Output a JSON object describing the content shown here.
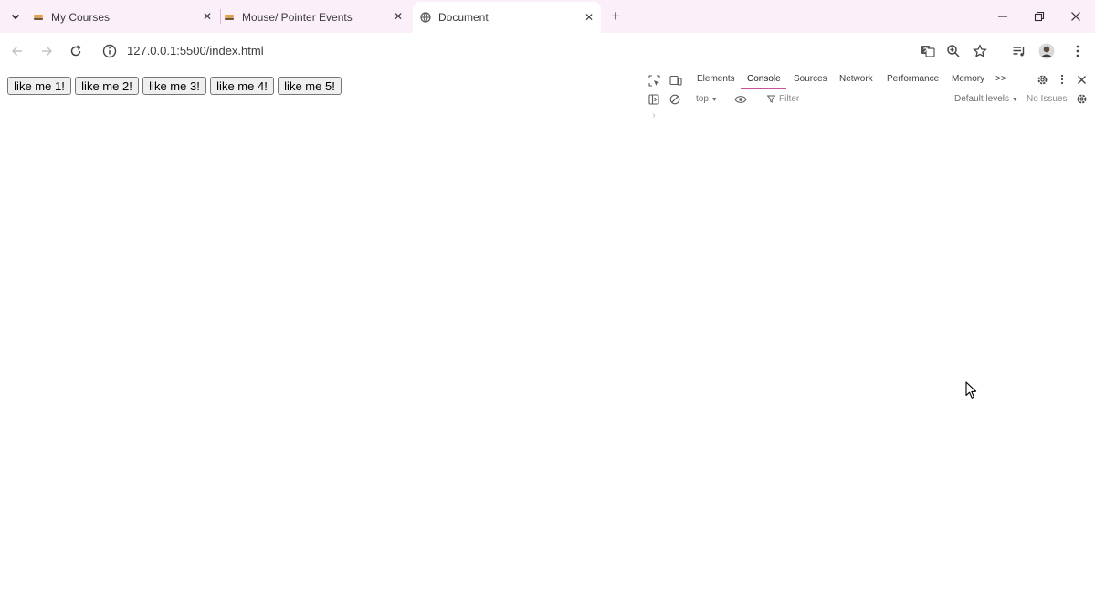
{
  "browser": {
    "tabs": [
      {
        "title": "My Courses",
        "favicon": "course-favicon",
        "active": false
      },
      {
        "title": "Mouse/ Pointer Events",
        "favicon": "course-favicon",
        "active": false
      },
      {
        "title": "Document",
        "favicon": "globe-icon",
        "active": true
      }
    ],
    "address": {
      "url": "127.0.0.1:5500/index.html"
    },
    "colors": {
      "tabstrip": "#fbf0fa",
      "accent": "#c7549b"
    }
  },
  "page": {
    "buttons": [
      "like me 1!",
      "like me 2!",
      "like me 3!",
      "like me 4!",
      "like me 5!"
    ]
  },
  "devtools": {
    "tabs": [
      "Elements",
      "Console",
      "Sources",
      "Network",
      "Performance",
      "Memory"
    ],
    "active_tab": "Console",
    "more_tabs_label": ">>",
    "context": "top",
    "filter_placeholder": "Filter",
    "levels_label": "Default levels",
    "issues_label": "No Issues",
    "prompt": "›"
  }
}
